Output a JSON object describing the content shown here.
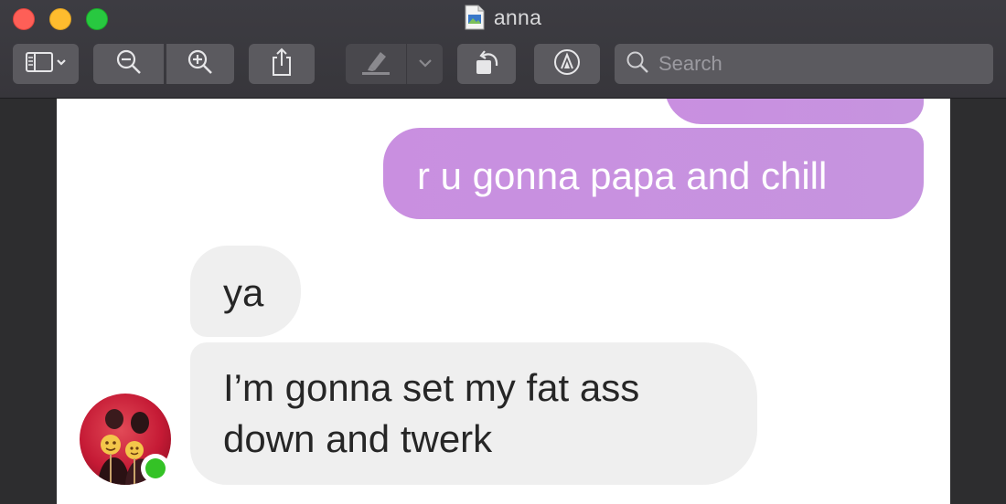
{
  "window": {
    "title": "anna"
  },
  "toolbar": {
    "sidebar_icon": "sidebar-icon",
    "zoom_out_icon": "zoom-out-icon",
    "zoom_in_icon": "zoom-in-icon",
    "share_icon": "share-icon",
    "highlight_icon": "highlighter-icon",
    "rotate_icon": "rotate-icon",
    "markup_icon": "markup-icon",
    "search_placeholder": "Search"
  },
  "conversation": {
    "messages": [
      {
        "direction": "out",
        "text": "r u gonna papa and chill"
      },
      {
        "direction": "in",
        "text": "ya"
      },
      {
        "direction": "in",
        "text_line1": "I’m gonna set my fat ass",
        "text_line2": "down and twerk"
      }
    ],
    "presence_status": "online"
  },
  "colors": {
    "outgoing_bubble": "#c98fe0",
    "incoming_bubble": "#efefef",
    "presence": "#34c226"
  }
}
